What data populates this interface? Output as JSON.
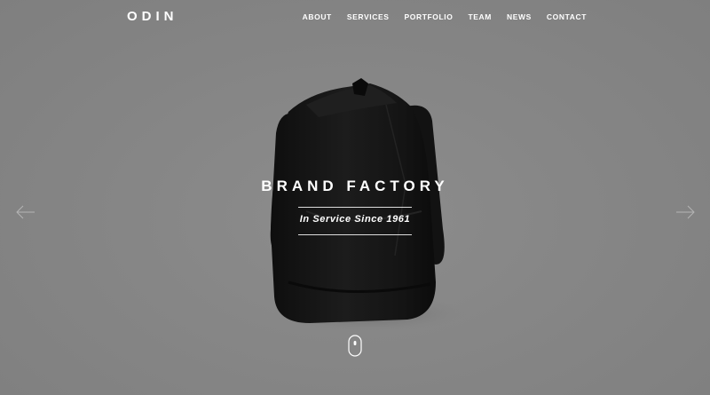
{
  "brand": {
    "logo": "ODIN"
  },
  "nav": {
    "items": [
      {
        "label": "ABOUT"
      },
      {
        "label": "SERVICES"
      },
      {
        "label": "PORTFOLIO"
      },
      {
        "label": "TEAM"
      },
      {
        "label": "NEWS"
      },
      {
        "label": "CONTACT"
      }
    ]
  },
  "hero": {
    "title": "BRAND FACTORY",
    "subtitle": "In Service Since 1961",
    "image": "black-backpack"
  },
  "controls": {
    "prev_icon": "arrow-left-icon",
    "next_icon": "arrow-right-icon",
    "scroll_icon": "mouse-scroll-icon"
  },
  "colors": {
    "background": "#868686",
    "text": "#ffffff",
    "bag": "#161616"
  }
}
